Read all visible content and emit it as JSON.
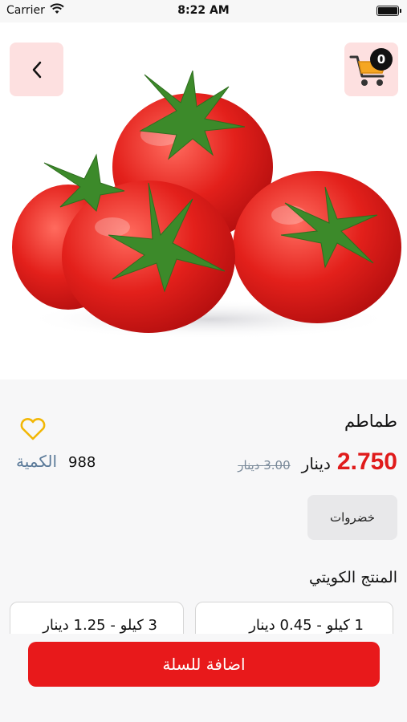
{
  "status_bar": {
    "carrier": "Carrier",
    "time": "8:22 AM"
  },
  "header": {
    "back_icon": "chevron-left-icon",
    "cart_icon": "shopping-cart-icon",
    "cart_count": "0"
  },
  "product": {
    "name": "طماطم",
    "price": "2.750",
    "currency": "دينار",
    "old_price": "3.00 دينار",
    "quantity_label": "الكمية",
    "quantity_value": "988",
    "category": "خضروات",
    "favorite_icon": "heart-icon"
  },
  "options": {
    "section_title": "المنتج الكويتي",
    "items": [
      {
        "label": "1 كيلو - 0.45  دينار"
      },
      {
        "label": "3 كيلو - 1.25  دينار"
      }
    ]
  },
  "actions": {
    "add_to_cart": "اضافة للسلة"
  },
  "colors": {
    "accent_red": "#e8191b",
    "button_pink": "#fde0e0",
    "heart_yellow": "#f2b705"
  }
}
